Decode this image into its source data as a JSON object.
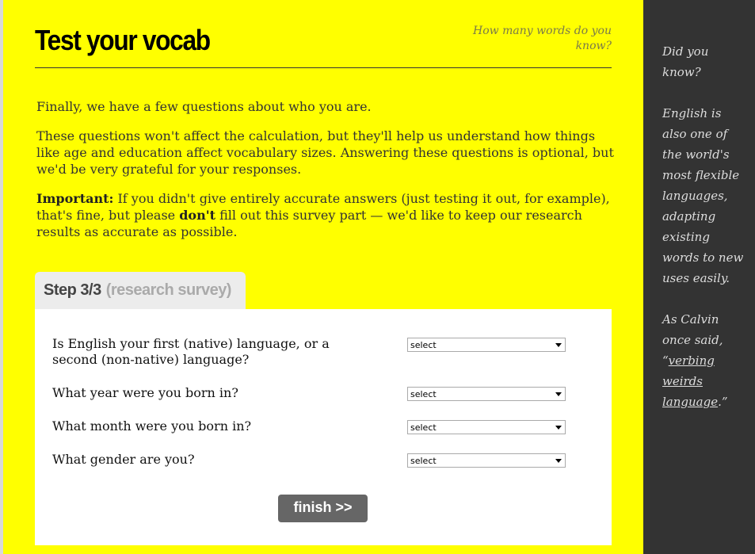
{
  "header": {
    "title": "Test your vocab",
    "tagline": "How many words do you know?"
  },
  "intro": {
    "p1": "Finally, we have a few questions about who you are.",
    "p2": "These questions won't affect the calculation, but they'll help us understand how things like age and education affect vocabulary sizes. Answering these questions is optional, but we'd be very grateful for your responses.",
    "p3_strong": "Important:",
    "p3_a": " If you didn't give entirely accurate answers (just testing it out, for example), that's fine, but please ",
    "p3_dont": "don't",
    "p3_b": " fill out this survey part — we'd like to keep our research results as accurate as possible."
  },
  "tab": {
    "step": "Step 3/3",
    "sub": "(research survey)"
  },
  "survey": {
    "questions": [
      {
        "label": "Is English your first (native) language, or a second (non-native) language?",
        "value": "select"
      },
      {
        "label": "What year were you born in?",
        "value": "select"
      },
      {
        "label": "What month were you born in?",
        "value": "select"
      },
      {
        "label": "What gender are you?",
        "value": "select"
      }
    ],
    "finish_label": "finish >>"
  },
  "sidebar": {
    "p1": "Did you know?",
    "p2": "English is also one of the world's most flexible languages, adapting existing words to new uses easily.",
    "p3_a": "As Calvin once said, “",
    "p3_link": "verbing weirds language",
    "p3_b": ".”"
  }
}
